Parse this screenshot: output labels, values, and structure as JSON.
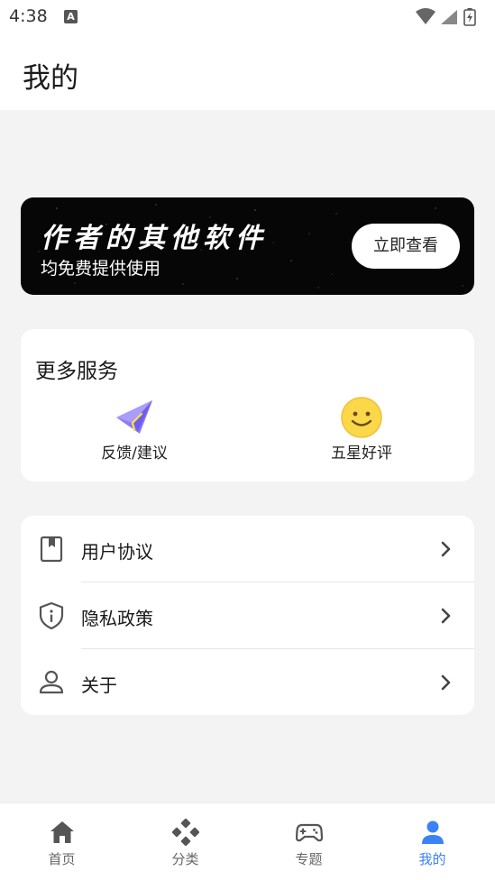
{
  "status_bar": {
    "time": "4:38",
    "notification_icon": "A",
    "icons": [
      "wifi-icon",
      "signal-icon",
      "battery-charging-icon"
    ]
  },
  "header": {
    "title": "我的"
  },
  "banner": {
    "title": "作者的其他软件",
    "subtitle": "均免费提供使用",
    "button_label": "立即查看"
  },
  "services": {
    "title": "更多服务",
    "items": [
      {
        "label": "反馈/建议",
        "icon": "paper-plane-icon"
      },
      {
        "label": "五星好评",
        "icon": "smiley-icon"
      }
    ]
  },
  "menu": {
    "items": [
      {
        "label": "用户协议",
        "icon": "bookmark-icon"
      },
      {
        "label": "隐私政策",
        "icon": "shield-info-icon"
      },
      {
        "label": "关于",
        "icon": "user-icon"
      }
    ]
  },
  "bottom_nav": {
    "items": [
      {
        "label": "首页",
        "icon": "home-icon",
        "active": false
      },
      {
        "label": "分类",
        "icon": "category-dpad-icon",
        "active": false
      },
      {
        "label": "专题",
        "icon": "gamepad-icon",
        "active": false
      },
      {
        "label": "我的",
        "icon": "person-icon",
        "active": true
      }
    ]
  },
  "colors": {
    "accent": "#3b82f6",
    "banner_background": "#060606",
    "page_background": "#f3f3f3",
    "paper_plane": "#8b7cf6",
    "smiley": "#fbd74a"
  }
}
